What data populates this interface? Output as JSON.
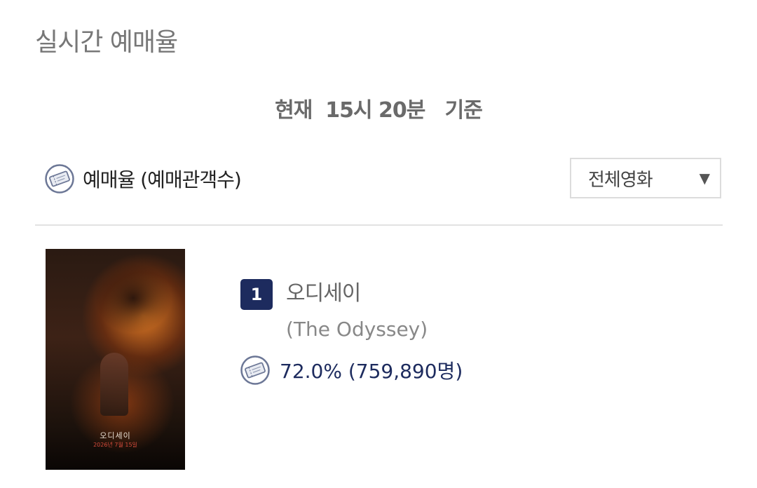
{
  "page": {
    "title": "실시간 예매율",
    "time_line": "현재  15시 20분   기준"
  },
  "header": {
    "rate_label": "예매율 (예매관객수)",
    "filter": {
      "selected": "전체영화",
      "caret": "▼"
    }
  },
  "movies": [
    {
      "rank": "1",
      "title": "오디세이",
      "original_title": "(The Odyssey)",
      "rate_text": "72.0% (759,890명)",
      "poster": {
        "title": "오디세이",
        "subtitle": "2026년 7월 15일"
      }
    }
  ],
  "icons": {
    "ticket": "ticket-icon",
    "caret": "chevron-down-icon"
  },
  "colors": {
    "accent": "#1d2b5e",
    "title_gray": "#777777",
    "divider": "#e2e2e2"
  }
}
